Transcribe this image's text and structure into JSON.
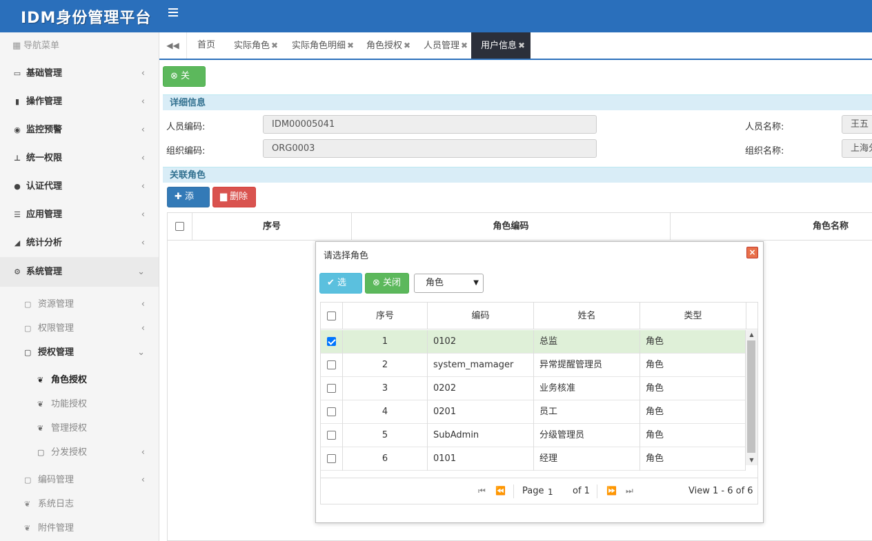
{
  "app": {
    "title": "IDM身份管理平台"
  },
  "sidebar": {
    "header": "导航菜单",
    "items": [
      {
        "label": "基础管理",
        "icon": "id-card-icon"
      },
      {
        "label": "操作管理",
        "icon": "book-icon"
      },
      {
        "label": "监控预警",
        "icon": "eye-icon"
      },
      {
        "label": "统一权限",
        "icon": "sitemap-icon"
      },
      {
        "label": "认证代理",
        "icon": "users-icon"
      },
      {
        "label": "应用管理",
        "icon": "list-icon"
      },
      {
        "label": "统计分析",
        "icon": "area-chart-icon"
      },
      {
        "label": "系统管理",
        "icon": "gears-icon"
      }
    ],
    "system_sub": [
      {
        "label": "资源管理"
      },
      {
        "label": "权限管理"
      },
      {
        "label": "授权管理"
      }
    ],
    "auth_sub": [
      {
        "label": "角色授权"
      },
      {
        "label": "功能授权"
      },
      {
        "label": "管理授权"
      },
      {
        "label": "分发授权"
      }
    ],
    "tail": [
      {
        "label": "编码管理"
      },
      {
        "label": "系统日志"
      },
      {
        "label": "附件管理"
      }
    ]
  },
  "tabs": [
    {
      "label": "首页"
    },
    {
      "label": "实际角色"
    },
    {
      "label": "实际角色明细"
    },
    {
      "label": "角色授权"
    },
    {
      "label": "人员管理"
    },
    {
      "label": "用户信息"
    }
  ],
  "toolbar": {
    "close_label": "关闭"
  },
  "detail": {
    "section_title": "详细信息",
    "person_code_label": "人员编码:",
    "person_code": "IDM00005041",
    "person_name_label": "人员名称:",
    "person_name": "王五",
    "org_code_label": "组织编码:",
    "org_code": "ORG0003",
    "org_name_label": "组织名称:",
    "org_name": "上海分"
  },
  "roles": {
    "section_title": "关联角色",
    "add_label": "添加",
    "delete_label": "删除",
    "columns": [
      "序号",
      "角色编码",
      "角色名称"
    ]
  },
  "modal": {
    "title": "请选择角色",
    "select_label": "选择",
    "close_label": "关闭",
    "type_select": "角色",
    "columns": [
      "序号",
      "编码",
      "姓名",
      "类型"
    ],
    "rows": [
      {
        "no": "1",
        "code": "0102",
        "name": "总监",
        "type": "角色",
        "checked": true
      },
      {
        "no": "2",
        "code": "system_mamager",
        "name": "异常提醒管理员",
        "type": "角色",
        "checked": false
      },
      {
        "no": "3",
        "code": "0202",
        "name": "业务核准",
        "type": "角色",
        "checked": false
      },
      {
        "no": "4",
        "code": "0201",
        "name": "员工",
        "type": "角色",
        "checked": false
      },
      {
        "no": "5",
        "code": "SubAdmin",
        "name": "分级管理员",
        "type": "角色",
        "checked": false
      },
      {
        "no": "6",
        "code": "0101",
        "name": "经理",
        "type": "角色",
        "checked": false
      }
    ],
    "pager": {
      "page_label": "Page",
      "page": "1",
      "of_label": "of 1",
      "view": "View 1 - 6 of 6"
    }
  },
  "colors": {
    "primary": "#2a6fbb",
    "success": "#5cb85c",
    "danger": "#d9534f",
    "info": "#5bc0de",
    "selected_row": "#dff0d8"
  }
}
